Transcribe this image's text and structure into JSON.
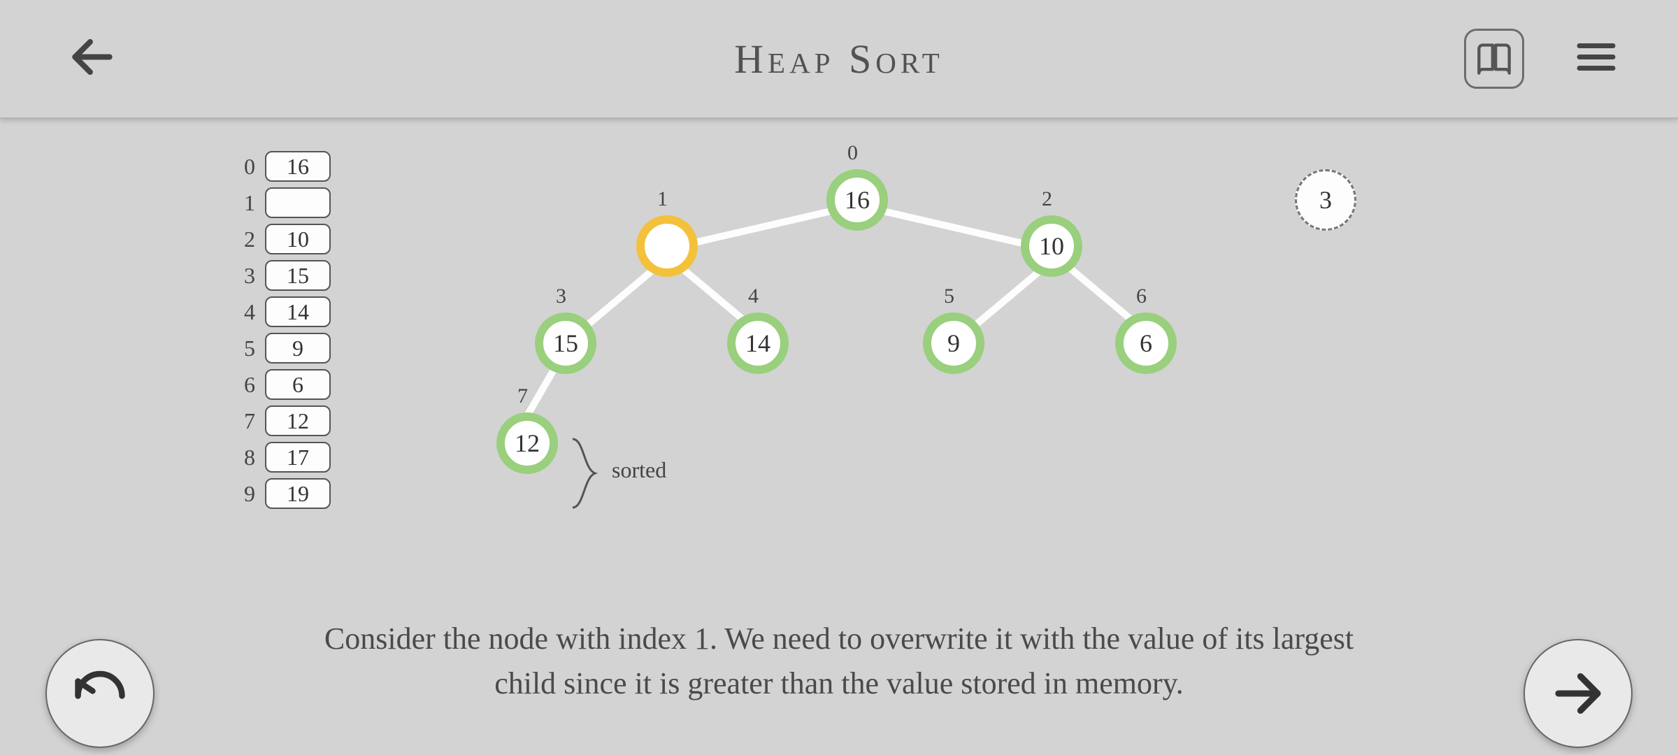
{
  "header": {
    "title": "Heap Sort"
  },
  "array": {
    "rows": [
      {
        "index": "0",
        "value": "16"
      },
      {
        "index": "1",
        "value": ""
      },
      {
        "index": "2",
        "value": "10"
      },
      {
        "index": "3",
        "value": "15"
      },
      {
        "index": "4",
        "value": "14"
      },
      {
        "index": "5",
        "value": "9"
      },
      {
        "index": "6",
        "value": "6"
      },
      {
        "index": "7",
        "value": "12"
      },
      {
        "index": "8",
        "value": "17"
      },
      {
        "index": "9",
        "value": "19"
      }
    ],
    "sorted_label": "sorted",
    "sorted_start_index": 8
  },
  "tree": {
    "nodes": {
      "n0": {
        "label": "0",
        "value": "16"
      },
      "n1": {
        "label": "1",
        "value": ""
      },
      "n2": {
        "label": "2",
        "value": "10"
      },
      "n3": {
        "label": "3",
        "value": "15"
      },
      "n4": {
        "label": "4",
        "value": "14"
      },
      "n5": {
        "label": "5",
        "value": "9"
      },
      "n6": {
        "label": "6",
        "value": "6"
      },
      "n7": {
        "label": "7",
        "value": "12"
      }
    },
    "memory": {
      "value": "3"
    }
  },
  "caption": "Consider the node with index 1. We need to overwrite it with the value of its largest child since it is greater than the value stored in memory."
}
